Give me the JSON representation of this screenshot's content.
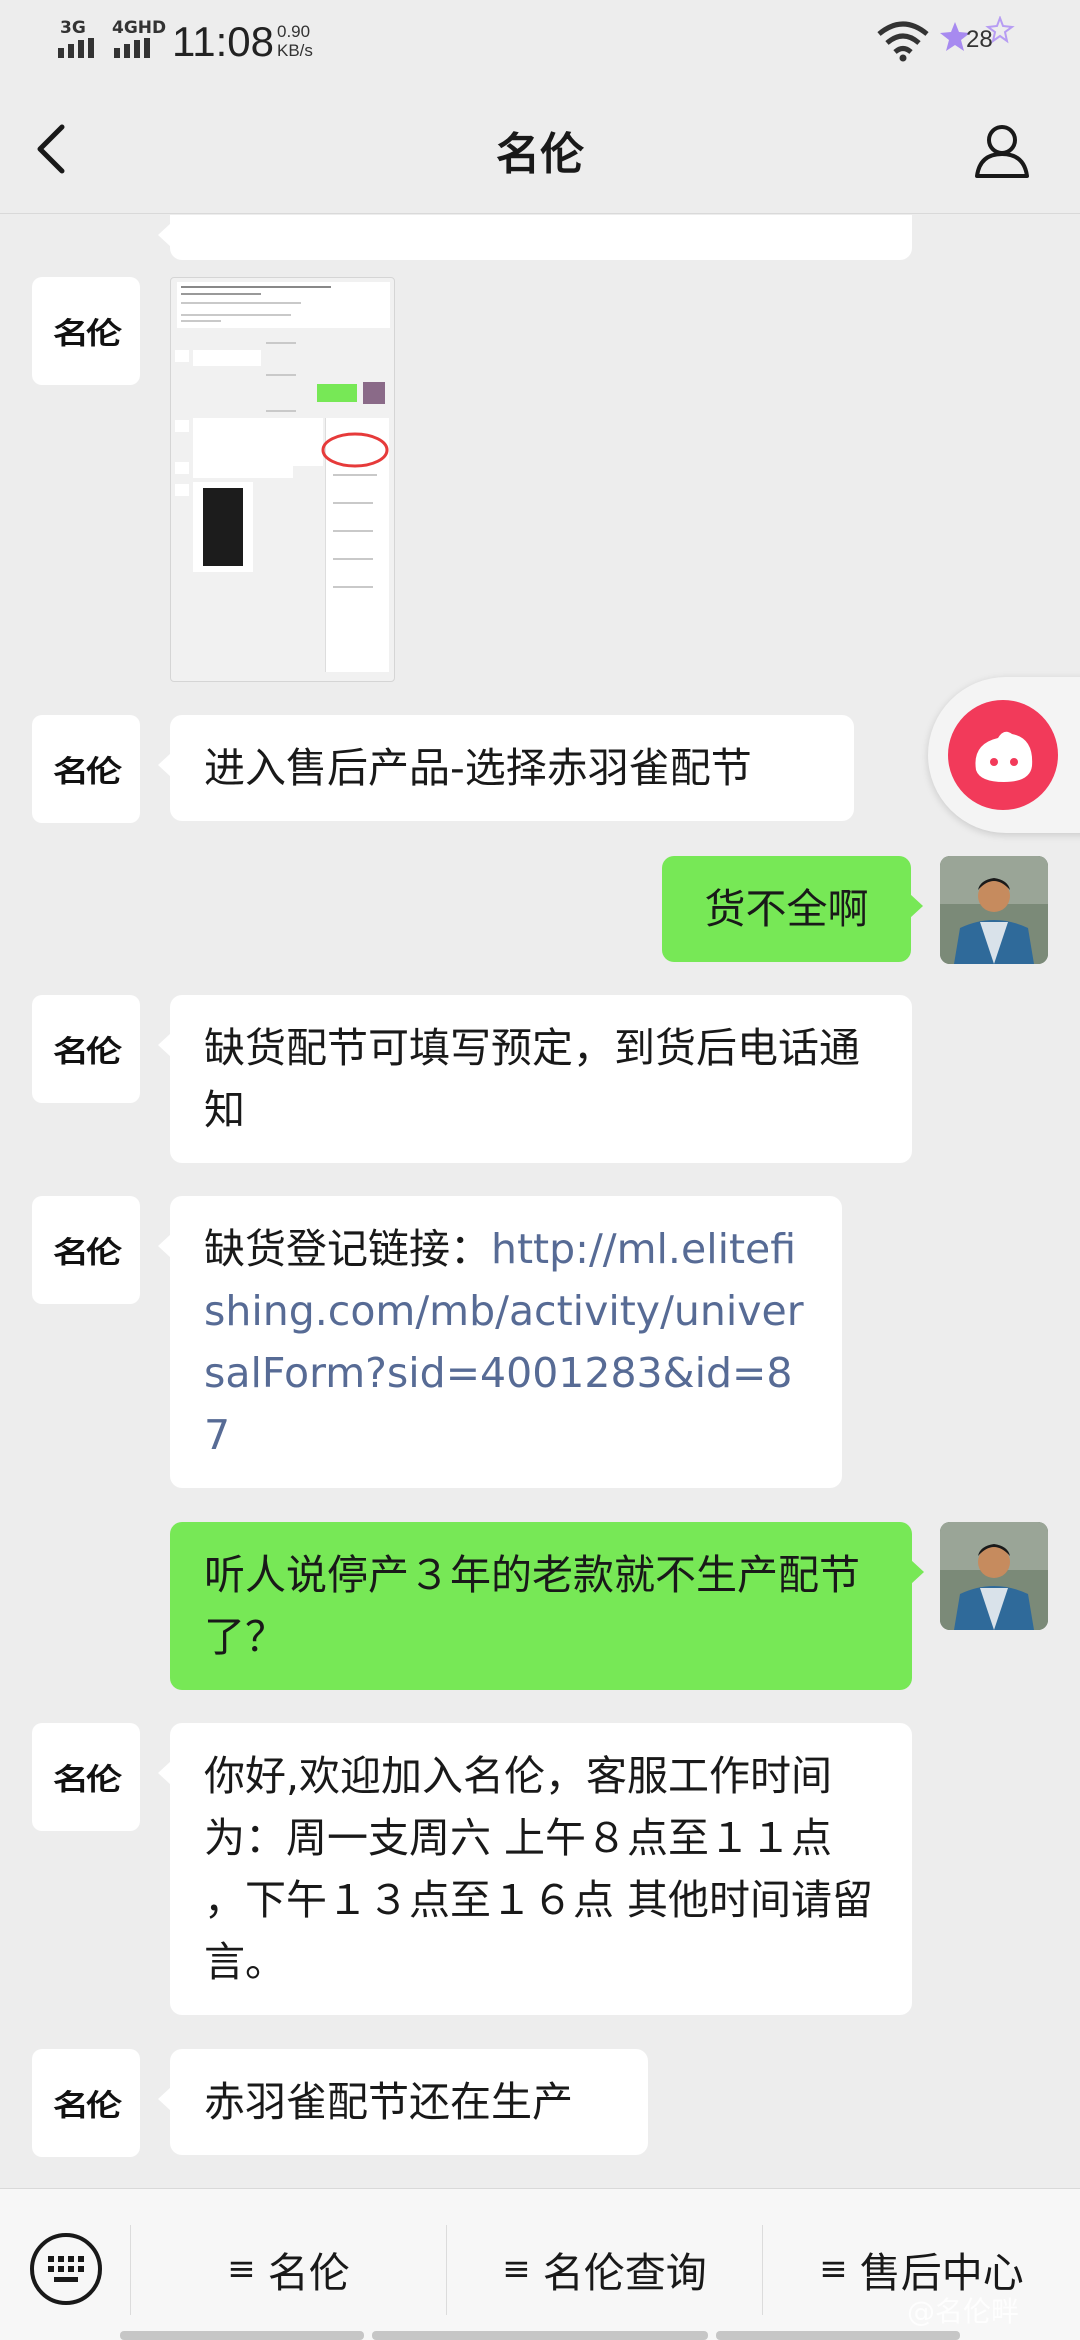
{
  "status_bar": {
    "network_1": "3G",
    "network_2": "4GHD",
    "time": "11:08",
    "speed_value": "0.90",
    "speed_unit": "KB/s",
    "battery": "28"
  },
  "nav": {
    "title": "名伦",
    "back_icon": "chevron-left-icon",
    "profile_icon": "person-icon"
  },
  "avatar_logo_text": "名伦",
  "messages": [
    {
      "side": "left",
      "type": "image",
      "alt": "screenshot"
    },
    {
      "side": "left",
      "type": "text",
      "text": "进入售后产品-选择赤羽雀配节"
    },
    {
      "side": "right",
      "type": "text",
      "text": "货不全啊"
    },
    {
      "side": "left",
      "type": "text",
      "text": "缺货配节可填写预定，到货后电话通知"
    },
    {
      "side": "left",
      "type": "link",
      "prefix": "缺货登记链接：",
      "link": "http://ml.elitefishing.com/mb/activity/universalForm?sid=4001283&id=87"
    },
    {
      "side": "right",
      "type": "text",
      "text": "听人说停产３年的老款就不生产配节了？"
    },
    {
      "side": "left",
      "type": "text",
      "text": "你好,欢迎加入名伦，客服工作时间为：周一支周六 上午８点至１１点 ，下午１３点至１６点 其他时间请留言。"
    },
    {
      "side": "left",
      "type": "text",
      "text": "赤羽雀配节还在生产"
    }
  ],
  "bottom_menu": {
    "keyboard_icon": "keyboard-icon",
    "items": [
      {
        "label": "名伦"
      },
      {
        "label": "名伦查询"
      },
      {
        "label": "售后中心"
      }
    ]
  },
  "watermark": "@名伦畔",
  "colors": {
    "background": "#ededed",
    "bubble_green": "#77e856",
    "bubble_white": "#ffffff",
    "link": "#576b95",
    "float_button": "#f23a5a"
  }
}
